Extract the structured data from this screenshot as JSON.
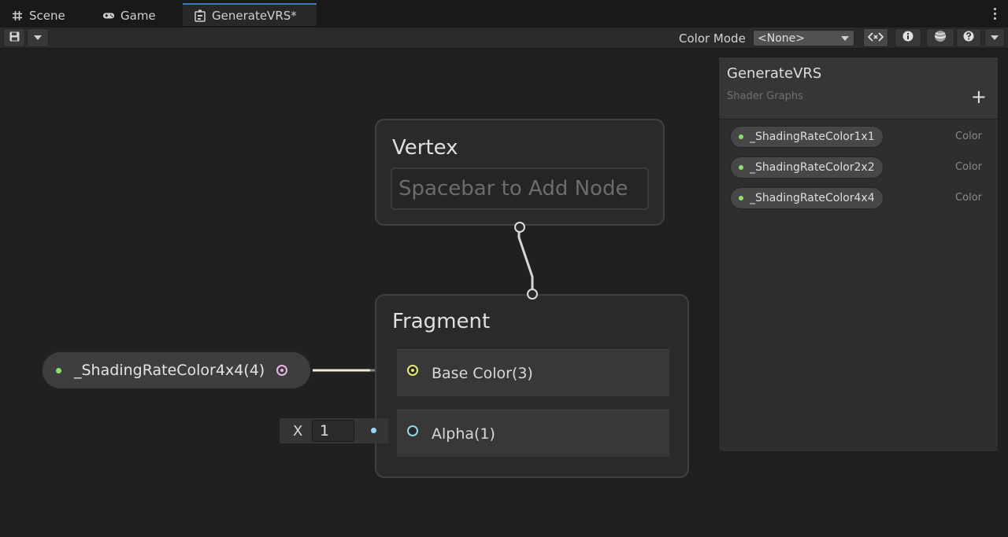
{
  "tabs": [
    {
      "label": "Scene",
      "icon": "grid-icon"
    },
    {
      "label": "Game",
      "icon": "gamepad-icon"
    },
    {
      "label": "GenerateVRS*",
      "icon": "shader-graph-icon",
      "active": true
    }
  ],
  "toolbar": {
    "color_mode_label": "Color Mode",
    "color_mode_value": "<None>",
    "buttons": [
      "save-icon",
      "dropdown-icon",
      "code-preview-icon",
      "info-icon",
      "main-preview-icon",
      "help-icon",
      "options-dropdown-icon"
    ]
  },
  "graph": {
    "vertex": {
      "title": "Vertex",
      "placeholder": "Spacebar to Add Node"
    },
    "fragment": {
      "title": "Fragment",
      "slots": [
        {
          "label": "Base Color(3)",
          "port_color": "#e8e87a"
        },
        {
          "label": "Alpha(1)",
          "port_color": "#8fd8f0"
        }
      ]
    },
    "property_node": {
      "label": "_ShadingRateColor4x4(4)",
      "port_color": "#e8b6e6"
    },
    "alpha_input": {
      "axis": "X",
      "value": "1"
    }
  },
  "blackboard": {
    "title": "GenerateVRS",
    "subtitle": "Shader Graphs",
    "properties": [
      {
        "name": "_ShadingRateColor1x1",
        "type": "Color"
      },
      {
        "name": "_ShadingRateColor2x2",
        "type": "Color"
      },
      {
        "name": "_ShadingRateColor4x4",
        "type": "Color"
      }
    ]
  },
  "colors": {
    "accent": "#3a79bb",
    "property_dot": "#8be06c",
    "wire_color": "#f1eccb",
    "wire_alpha": "#8fd8f0"
  }
}
